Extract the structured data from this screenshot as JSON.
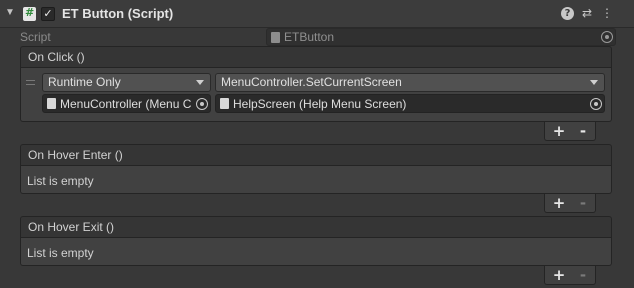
{
  "component": {
    "title": "ET Button (Script)",
    "enabled_mark": "✓",
    "header_icons": [
      "help-icon",
      "presets-icon",
      "kebab-menu-icon"
    ],
    "help_glyph": "?",
    "presets_glyph": "⇄",
    "menu_glyph": "⋮",
    "fold_glyph": "▼"
  },
  "script_field": {
    "label": "Script",
    "value": "ETButton"
  },
  "on_click": {
    "header": "On Click ()",
    "runtime_mode": "Runtime Only",
    "function": "MenuController.SetCurrentScreen",
    "target_object": "MenuController (Menu C",
    "argument_object": "HelpScreen (Help Menu Screen)"
  },
  "on_hover_enter": {
    "header": "On Hover Enter ()",
    "empty_text": "List is empty"
  },
  "on_hover_exit": {
    "header": "On Hover Exit ()",
    "empty_text": "List is empty"
  },
  "list_controls": {
    "plus": "+",
    "minus": "-"
  },
  "colors": {
    "background": "#383838",
    "header_bg": "#3c3c3c",
    "field_bg": "#2a2a2a",
    "dropdown_bg": "#515151",
    "script_icon_green": "#2f8a3a"
  }
}
